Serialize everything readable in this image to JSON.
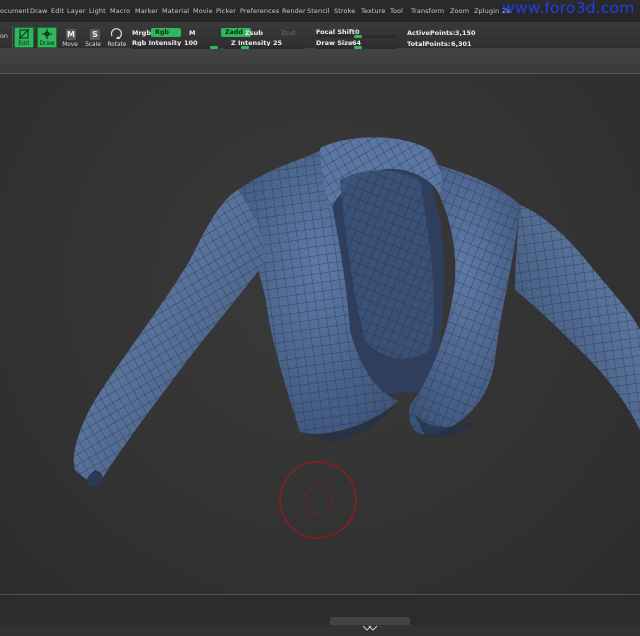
{
  "menu": {
    "items": [
      {
        "label": "ocument"
      },
      {
        "label": "Draw"
      },
      {
        "label": "Edit"
      },
      {
        "label": "Layer"
      },
      {
        "label": "Light"
      },
      {
        "label": "Macro"
      },
      {
        "label": "Marker"
      },
      {
        "label": "Material"
      },
      {
        "label": "Movie"
      },
      {
        "label": "Picker"
      },
      {
        "label": "Preferences"
      },
      {
        "label": "Render"
      },
      {
        "label": "Stencil"
      },
      {
        "label": "Stroke"
      },
      {
        "label": "Texture"
      },
      {
        "label": "Tool"
      },
      {
        "label": "Transform"
      },
      {
        "label": "Zoom"
      },
      {
        "label": "Zplugin"
      },
      {
        "label": "Zs"
      }
    ],
    "watermark": "www.foro3d.com"
  },
  "toolbar": {
    "fragment_label": "on",
    "edit_label": "Edit",
    "draw_label": "Draw",
    "move_label": "Move",
    "move_key": "M",
    "scale_label": "Scale",
    "scale_key": "S",
    "rotate_label": "Rotate",
    "mrgb_label": "Mrgb",
    "rgb_label": "Rgb",
    "m_label": "M",
    "rgb_intensity_label": "Rgb Intensity",
    "rgb_intensity_value": "100",
    "zadd_label": "Zadd",
    "zsub_label": "Zsub",
    "zcut_label": "Zcut",
    "z_intensity_label": "Z Intensity",
    "z_intensity_value": "25",
    "focal_shift_label": "Focal Shift",
    "focal_shift_value": "0",
    "draw_size_label": "Draw Size",
    "draw_size_value": "64",
    "active_points_label": "ActivePoints:",
    "active_points_value": "3,150",
    "total_points_label": "TotalPoints:",
    "total_points_value": "6,301",
    "rgb_intensity_level": 1.0,
    "z_intensity_level": 0.25,
    "focal_shift_level": 0.5,
    "draw_size_level": 0.05
  },
  "colors": {
    "accent": "#2fb75b",
    "mesh": "#4a6490",
    "brush_cursor": "#a8151a",
    "watermark": "#1d3fe8"
  }
}
